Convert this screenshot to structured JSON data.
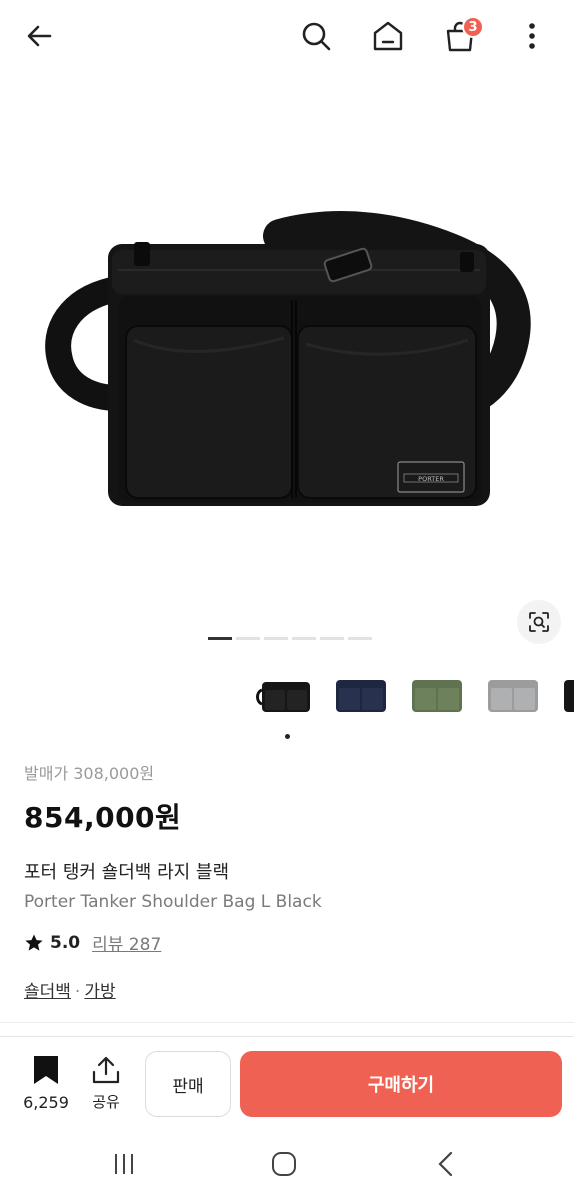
{
  "topbar": {
    "back_icon": "arrow-left-icon",
    "search_icon": "search-icon",
    "home_icon": "home-icon",
    "cart_icon": "shopping-bag-icon",
    "cart_count": "3",
    "more_icon": "more-vertical-icon"
  },
  "gallery": {
    "image": "black nylon shoulder bag with two front pockets and PORTER label",
    "label_text": "PORTER",
    "slide_count": 6,
    "active_slide": 1,
    "lens_icon": "image-search-icon"
  },
  "variants": [
    "black",
    "navy",
    "sage green",
    "silver gray",
    "black"
  ],
  "product": {
    "release_price": "발매가 308,000원",
    "price": "854,000원",
    "name_ko": "포터 탱커 숄더백 라지 블랙",
    "name_en": "Porter Tanker Shoulder Bag L Black",
    "rating": "5.0",
    "review_text": "리뷰 287",
    "categories": [
      "숄더백",
      "가방"
    ],
    "category_separator": "·"
  },
  "bottom_bar": {
    "wish_count": "6,259",
    "share_label": "공유",
    "sell_label": "판매",
    "buy_label": "구매하기"
  },
  "colors": {
    "accent": "#ef6253",
    "text_primary": "#222222",
    "text_secondary": "#7a7a7a"
  }
}
